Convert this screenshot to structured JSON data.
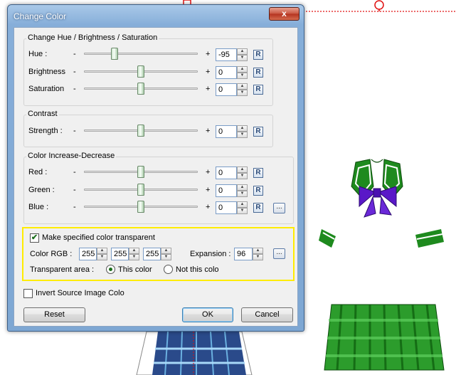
{
  "window": {
    "title": "Change Color",
    "close_glyph": "x"
  },
  "hbs_group": {
    "title": "Change Hue / Brightness / Saturation",
    "rows": [
      {
        "label": "Hue :",
        "minus": "-",
        "plus": "+",
        "value": "-95",
        "slider_fraction": 0.25,
        "reset": "R"
      },
      {
        "label": "Brightness",
        "minus": "-",
        "plus": "+",
        "value": "0",
        "slider_fraction": 0.5,
        "reset": "R"
      },
      {
        "label": "Saturation",
        "minus": "-",
        "plus": "+",
        "value": "0",
        "slider_fraction": 0.5,
        "reset": "R"
      }
    ]
  },
  "contrast_group": {
    "title": "Contrast",
    "rows": [
      {
        "label": "Strength :",
        "minus": "-",
        "plus": "+",
        "value": "0",
        "slider_fraction": 0.5,
        "reset": "R"
      }
    ]
  },
  "color_group": {
    "title": "Color Increase-Decrease",
    "rows": [
      {
        "label": "Red :",
        "minus": "-",
        "plus": "+",
        "value": "0",
        "slider_fraction": 0.5,
        "reset": "R"
      },
      {
        "label": "Green :",
        "minus": "-",
        "plus": "+",
        "value": "0",
        "slider_fraction": 0.5,
        "reset": "R"
      },
      {
        "label": "Blue :",
        "minus": "-",
        "plus": "+",
        "value": "0",
        "slider_fraction": 0.5,
        "reset": "R"
      }
    ],
    "picker_glyph": "..."
  },
  "transparent": {
    "checkbox_label": "Make specified color transparent",
    "checked": true,
    "rgb_label": "Color RGB :",
    "rgb": [
      "255",
      "255",
      "255"
    ],
    "expansion_label": "Expansion :",
    "expansion": "96",
    "picker_glyph": "...",
    "area_label": "Transparent area :",
    "option_this": "This color",
    "option_not": "Not this colo",
    "selected": "This color"
  },
  "invert": {
    "label": "Invert Source Image Colo",
    "checked": false
  },
  "buttons": {
    "reset": "Reset",
    "ok": "OK",
    "cancel": "Cancel"
  },
  "colors": {
    "highlight": "#ffec00",
    "uniform_green": "#1e8a1e",
    "bow_purple": "#5a18c8",
    "skirt_blue": "#2a4a8a",
    "guide_red": "#e01010"
  }
}
